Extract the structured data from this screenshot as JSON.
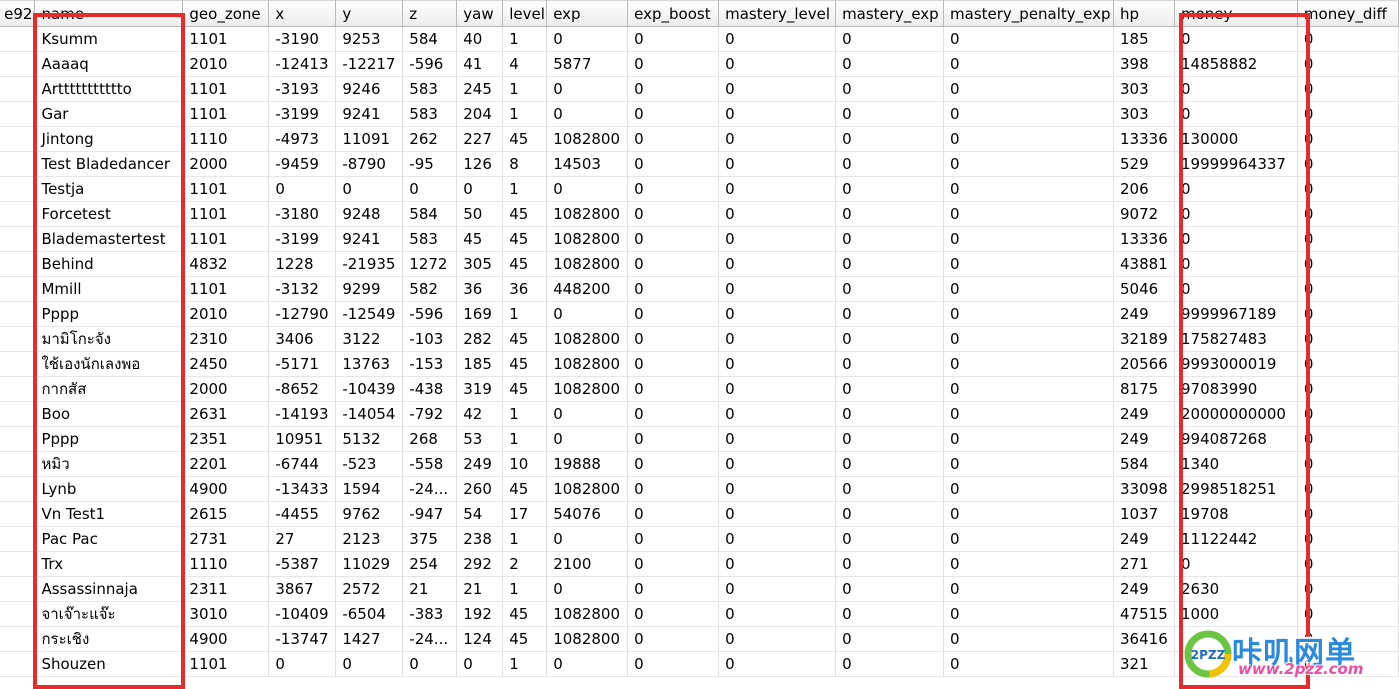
{
  "columns": [
    "e92",
    "name",
    "geo_zone",
    "x",
    "y",
    "z",
    "yaw",
    "level",
    "exp",
    "exp_boost",
    "mastery_level",
    "mastery_exp",
    "mastery_penalty_exp",
    "hp",
    "money",
    "money_diff"
  ],
  "rows": [
    [
      "",
      "Ksumm",
      "1101",
      "-3190",
      "9253",
      "584",
      "40",
      "1",
      "0",
      "0",
      "0",
      "0",
      "0",
      "185",
      "0",
      "0"
    ],
    [
      "",
      "Aaaaq",
      "2010",
      "-12413",
      "-12217",
      "-596",
      "41",
      "4",
      "5877",
      "0",
      "0",
      "0",
      "0",
      "398",
      "14858882",
      "0"
    ],
    [
      "",
      "Arttttttttttto",
      "1101",
      "-3193",
      "9246",
      "583",
      "245",
      "1",
      "0",
      "0",
      "0",
      "0",
      "0",
      "303",
      "0",
      "0"
    ],
    [
      "",
      "Gar",
      "1101",
      "-3199",
      "9241",
      "583",
      "204",
      "1",
      "0",
      "0",
      "0",
      "0",
      "0",
      "303",
      "0",
      "0"
    ],
    [
      "",
      "Jintong",
      "1110",
      "-4973",
      "11091",
      "262",
      "227",
      "45",
      "1082800",
      "0",
      "0",
      "0",
      "0",
      "13336",
      "130000",
      "0"
    ],
    [
      "",
      "Test Bladedancer",
      "2000",
      "-9459",
      "-8790",
      "-95",
      "126",
      "8",
      "14503",
      "0",
      "0",
      "0",
      "0",
      "529",
      "19999964337",
      "0"
    ],
    [
      "",
      "Testja",
      "1101",
      "0",
      "0",
      "0",
      "0",
      "1",
      "0",
      "0",
      "0",
      "0",
      "0",
      "206",
      "0",
      "0"
    ],
    [
      "",
      "Forcetest",
      "1101",
      "-3180",
      "9248",
      "584",
      "50",
      "45",
      "1082800",
      "0",
      "0",
      "0",
      "0",
      "9072",
      "0",
      "0"
    ],
    [
      "",
      "Blademastertest",
      "1101",
      "-3199",
      "9241",
      "583",
      "45",
      "45",
      "1082800",
      "0",
      "0",
      "0",
      "0",
      "13336",
      "0",
      "0"
    ],
    [
      "",
      "Behind",
      "4832",
      "1228",
      "-21935",
      "1272",
      "305",
      "45",
      "1082800",
      "0",
      "0",
      "0",
      "0",
      "43881",
      "0",
      "0"
    ],
    [
      "",
      "Mmill",
      "1101",
      "-3132",
      "9299",
      "582",
      "36",
      "36",
      "448200",
      "0",
      "0",
      "0",
      "0",
      "5046",
      "0",
      "0"
    ],
    [
      "",
      "Pppp",
      "2010",
      "-12790",
      "-12549",
      "-596",
      "169",
      "1",
      "0",
      "0",
      "0",
      "0",
      "0",
      "249",
      "9999967189",
      "0"
    ],
    [
      "",
      "มามิโกะจัง",
      "2310",
      "3406",
      "3122",
      "-103",
      "282",
      "45",
      "1082800",
      "0",
      "0",
      "0",
      "0",
      "32189",
      "175827483",
      "0"
    ],
    [
      "",
      "ใช้เองนักเลงพอ",
      "2450",
      "-5171",
      "13763",
      "-153",
      "185",
      "45",
      "1082800",
      "0",
      "0",
      "0",
      "0",
      "20566",
      "9993000019",
      "0"
    ],
    [
      "",
      "กากสัส",
      "2000",
      "-8652",
      "-10439",
      "-438",
      "319",
      "45",
      "1082800",
      "0",
      "0",
      "0",
      "0",
      "8175",
      "97083990",
      "0"
    ],
    [
      "",
      "Boo",
      "2631",
      "-14193",
      "-14054",
      "-792",
      "42",
      "1",
      "0",
      "0",
      "0",
      "0",
      "0",
      "249",
      "20000000000",
      "0"
    ],
    [
      "",
      "Pppp",
      "2351",
      "10951",
      "5132",
      "268",
      "53",
      "1",
      "0",
      "0",
      "0",
      "0",
      "0",
      "249",
      "994087268",
      "0"
    ],
    [
      "",
      "หมิว",
      "2201",
      "-6744",
      "-523",
      "-558",
      "249",
      "10",
      "19888",
      "0",
      "0",
      "0",
      "0",
      "584",
      "1340",
      "0"
    ],
    [
      "",
      "Lynb",
      "4900",
      "-13433",
      "1594",
      "-24...",
      "260",
      "45",
      "1082800",
      "0",
      "0",
      "0",
      "0",
      "33098",
      "2998518251",
      "0"
    ],
    [
      "",
      "Vn Test1",
      "2615",
      "-4455",
      "9762",
      "-947",
      "54",
      "17",
      "54076",
      "0",
      "0",
      "0",
      "0",
      "1037",
      "19708",
      "0"
    ],
    [
      "",
      "Pac Pac",
      "2731",
      "27",
      "2123",
      "375",
      "238",
      "1",
      "0",
      "0",
      "0",
      "0",
      "0",
      "249",
      "11122442",
      "0"
    ],
    [
      "",
      "Trx",
      "1110",
      "-5387",
      "11029",
      "254",
      "292",
      "2",
      "2100",
      "0",
      "0",
      "0",
      "0",
      "271",
      "0",
      "0"
    ],
    [
      "",
      "Assassinnaja",
      "2311",
      "3867",
      "2572",
      "21",
      "21",
      "1",
      "0",
      "0",
      "0",
      "0",
      "0",
      "249",
      "2630",
      "0"
    ],
    [
      "",
      "จาเจ๊าะแจ๊ะ",
      "3010",
      "-10409",
      "-6504",
      "-383",
      "192",
      "45",
      "1082800",
      "0",
      "0",
      "0",
      "0",
      "47515",
      "1000",
      "0"
    ],
    [
      "",
      "กระเชิง",
      "4900",
      "-13747",
      "1427",
      "-24...",
      "124",
      "45",
      "1082800",
      "0",
      "0",
      "0",
      "0",
      "36416",
      "",
      "0"
    ],
    [
      "",
      "Shouzen",
      "1101",
      "0",
      "0",
      "0",
      "0",
      "1",
      "0",
      "0",
      "0",
      "0",
      "0",
      "321",
      "",
      "0"
    ]
  ],
  "highlight_color": "#e52b2b",
  "watermark": {
    "text": "咔叽网单",
    "url": "www.2pzz.com",
    "logo_text": "2PZZ",
    "color_primary": "#2a8ae0",
    "color_secondary": "#e94fa4"
  }
}
